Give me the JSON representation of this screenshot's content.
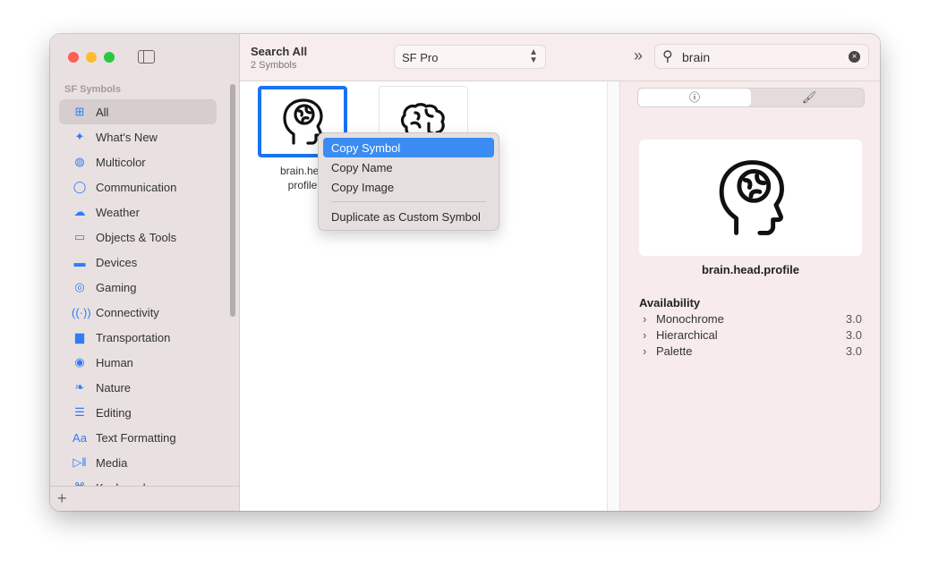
{
  "window": {
    "traffic_lights": [
      "#fe5f57",
      "#febc2e",
      "#28c840"
    ]
  },
  "sidebar": {
    "section": "SF Symbols",
    "items": [
      {
        "label": "All",
        "icon": "grid-icon",
        "glyph": "⊞"
      },
      {
        "label": "What's New",
        "icon": "sparkles-icon",
        "glyph": "✦"
      },
      {
        "label": "Multicolor",
        "icon": "palette-icon",
        "glyph": "◍"
      },
      {
        "label": "Communication",
        "icon": "bubble-icon",
        "glyph": "◯"
      },
      {
        "label": "Weather",
        "icon": "cloud-sun-icon",
        "glyph": "☁"
      },
      {
        "label": "Objects & Tools",
        "icon": "folder-icon",
        "glyph": "▭"
      },
      {
        "label": "Devices",
        "icon": "display-icon",
        "glyph": "▬"
      },
      {
        "label": "Gaming",
        "icon": "gamecontroller-icon",
        "glyph": "◎"
      },
      {
        "label": "Connectivity",
        "icon": "antenna-icon",
        "glyph": "((·))"
      },
      {
        "label": "Transportation",
        "icon": "car-icon",
        "glyph": "▆"
      },
      {
        "label": "Human",
        "icon": "person-circle-icon",
        "glyph": "◉"
      },
      {
        "label": "Nature",
        "icon": "leaf-icon",
        "glyph": "❧"
      },
      {
        "label": "Editing",
        "icon": "sliders-icon",
        "glyph": "☰"
      },
      {
        "label": "Text Formatting",
        "icon": "textformat-icon",
        "glyph": "Aa"
      },
      {
        "label": "Media",
        "icon": "playpause-icon",
        "glyph": "▷‖"
      },
      {
        "label": "Keyboard",
        "icon": "command-icon",
        "glyph": "⌘"
      }
    ]
  },
  "toolbar": {
    "title": "Search All",
    "subtitle": "2 Symbols",
    "font": "SF Pro",
    "search_value": "brain"
  },
  "grid": {
    "symbols": [
      {
        "name": "brain.head.profile",
        "caption_line1": "brain.hea",
        "caption_line2": "profile"
      },
      {
        "name": "brain"
      }
    ]
  },
  "context_menu": {
    "items": [
      "Copy Symbol",
      "Copy Name",
      "Copy Image",
      "Duplicate as Custom Symbol"
    ]
  },
  "inspector": {
    "tabs": [
      "info",
      "paintbrush"
    ],
    "info_glyph": "ⓘ",
    "symbol_name": "brain.head.profile",
    "availability_title": "Availability",
    "availability": [
      {
        "label": "Monochrome",
        "version": "3.0"
      },
      {
        "label": "Hierarchical",
        "version": "3.0"
      },
      {
        "label": "Palette",
        "version": "3.0"
      }
    ]
  },
  "colors": {
    "accent": "#1a73f0",
    "menu_highlight": "#3a8cf3"
  }
}
